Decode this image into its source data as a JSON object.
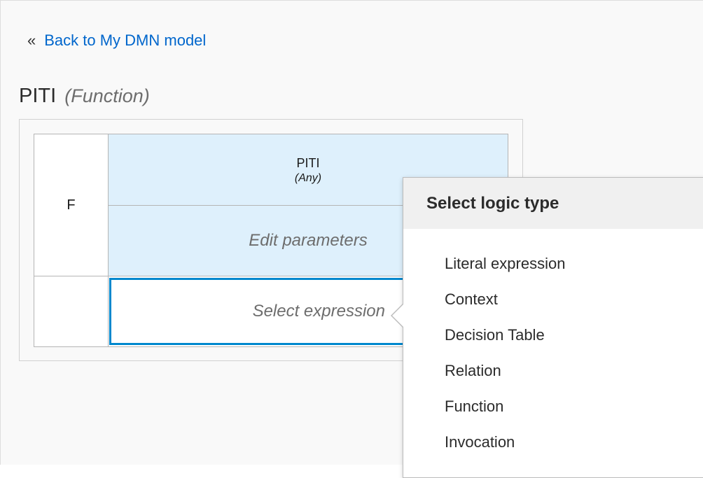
{
  "nav": {
    "back_icon": "«",
    "back_label": "Back to My DMN model"
  },
  "header": {
    "title": "PITI",
    "kind": "(Function)"
  },
  "function_grid": {
    "kind_letter": "F",
    "name": "PITI",
    "type": "(Any)",
    "parameters_label": "Edit parameters",
    "expression_placeholder": "Select expression"
  },
  "logic_popover": {
    "title": "Select logic type",
    "options": [
      "Literal expression",
      "Context",
      "Decision Table",
      "Relation",
      "Function",
      "Invocation"
    ]
  },
  "colors": {
    "link": "#0066cc",
    "header_cell_bg": "#def0fc",
    "selected_border": "#0088ce",
    "popover_header_bg": "#f0f0f0"
  }
}
